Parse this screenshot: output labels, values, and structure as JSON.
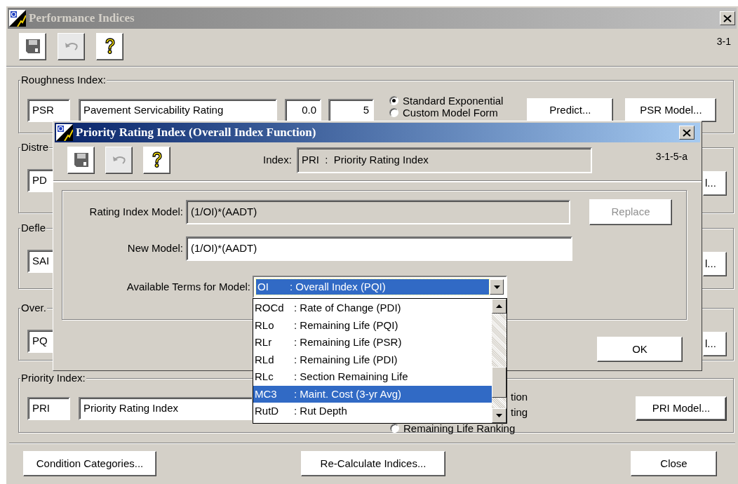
{
  "main_window": {
    "title": "Performance Indices",
    "screen_id": "3-1",
    "toolbar": [
      {
        "kind": "save",
        "disabled": false
      },
      {
        "kind": "undo",
        "disabled": true
      },
      {
        "kind": "help",
        "disabled": false
      }
    ],
    "groups": [
      {
        "kind": "roughness",
        "label": "Roughness Index:",
        "code": "PSR",
        "name": "Pavement Servicability Rating",
        "min": "0.0",
        "max": "5",
        "options": [
          {
            "label": "Standard Exponential",
            "selected": true
          },
          {
            "label": "Custom Model Form",
            "selected": false
          }
        ],
        "buttons": [
          "Predict...",
          "PSR Model..."
        ]
      },
      {
        "kind": "partial",
        "label": "Distre",
        "code": "PD",
        "button": "l..."
      },
      {
        "kind": "partial",
        "label": "Defle",
        "code": "SAI",
        "button": "l..."
      },
      {
        "kind": "partial",
        "label": "Over.",
        "code": "PQ",
        "button": "l..."
      },
      {
        "kind": "priority",
        "label": "Priority Index:",
        "code": "PRI",
        "name": "Priority Rating Index",
        "option_fragments": [
          "tion",
          "ting"
        ],
        "ranking_option": {
          "label": "Remaining Life Ranking",
          "selected": false
        },
        "button": "PRI Model..."
      }
    ],
    "footer_buttons": [
      "Condition Categories...",
      "Re-Calculate Indices...",
      "Close"
    ]
  },
  "dialog": {
    "title": "Priority Rating Index (Overall Index Function)",
    "screen_id": "3-1-5-a",
    "toolbar": [
      {
        "kind": "save",
        "disabled": false
      },
      {
        "kind": "undo",
        "disabled": true
      },
      {
        "kind": "help",
        "disabled": false
      }
    ],
    "index_label": "Index:",
    "index_value": "PRI  :  Priority Rating Index",
    "rating_model_label": "Rating Index Model:",
    "rating_model_value": "(1/OI)*(AADT)",
    "replace_button": {
      "label": "Replace",
      "disabled": true
    },
    "new_model_label": "New Model:",
    "new_model_value": "(1/OI)*(AADT)",
    "terms_label": "Available Terms for Model:",
    "terms_value": {
      "code": "OI",
      "desc": ": Overall Index (PQI)"
    },
    "terms_list": [
      {
        "code": "ROCd",
        "desc": ": Rate of Change (PDI)",
        "selected": false
      },
      {
        "code": "RLo",
        "desc": ": Remaining Life (PQI)",
        "selected": false
      },
      {
        "code": "RLr",
        "desc": ": Remaining Life (PSR)",
        "selected": false
      },
      {
        "code": "RLd",
        "desc": ": Remaining Life (PDI)",
        "selected": false
      },
      {
        "code": "RLc",
        "desc": ": Section Remaining Life",
        "selected": false
      },
      {
        "code": "MC3",
        "desc": ": Maint. Cost (3-yr Avg)",
        "selected": true
      },
      {
        "code": "RutD",
        "desc": ": Rut Depth",
        "selected": false
      }
    ],
    "ok_button": "OK"
  }
}
